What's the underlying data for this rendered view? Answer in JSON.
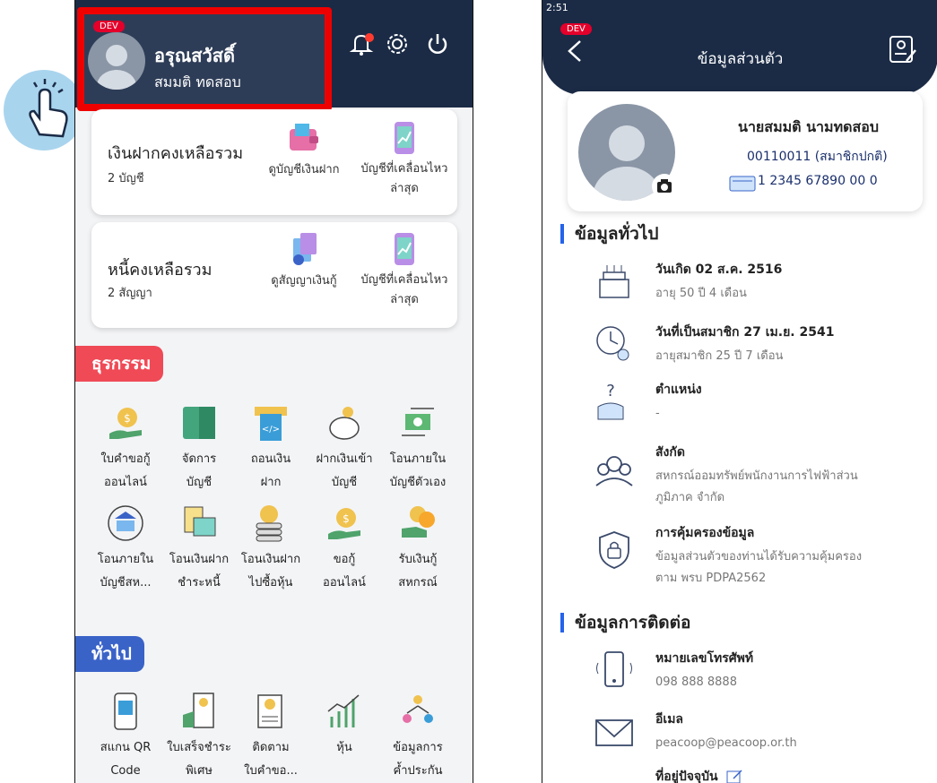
{
  "left": {
    "dev_badge": "DEV",
    "user_name": "อรุณสวัสดิ์",
    "user_sub": "สมมติ ทดสอบ",
    "deposit_card": {
      "title": "เงินฝากคงเหลือรวม",
      "sub": "2 บัญชี",
      "action1": "ดูบัญชีเงินฝาก",
      "action2_line1": "บัญชีที่เคลื่อนไหว",
      "action2_line2": "ล่าสุด"
    },
    "loan_card": {
      "title": "หนี้คงเหลือรวม",
      "sub": "2 สัญญา",
      "action1": "ดูสัญญาเงินกู้",
      "action2_line1": "บัญชีที่เคลื่อนไหว",
      "action2_line2": "ล่าสุด"
    },
    "section_transactions": "ธุรกรรม",
    "transactions": [
      {
        "l1": "ใบคำขอกู้",
        "l2": "ออนไลน์"
      },
      {
        "l1": "จัดการ",
        "l2": "บัญชี"
      },
      {
        "l1": "ถอนเงิน",
        "l2": "ฝาก"
      },
      {
        "l1": "ฝากเงินเข้า",
        "l2": "บัญชี"
      },
      {
        "l1": "โอนภายใน",
        "l2": "บัญชีตัวเอง"
      },
      {
        "l1": "โอนภายใน",
        "l2": "บัญชีสห..."
      },
      {
        "l1": "โอนเงินฝาก",
        "l2": "ชำระหนี้"
      },
      {
        "l1": "โอนเงินฝาก",
        "l2": "ไปซื้อหุ้น"
      },
      {
        "l1": "ขอกู้",
        "l2": "ออนไลน์"
      },
      {
        "l1": "รับเงินกู้",
        "l2": "สหกรณ์"
      }
    ],
    "section_general": "ทั่วไป",
    "general": [
      {
        "l1": "สแกน QR",
        "l2": "Code"
      },
      {
        "l1": "ใบเสร็จชำระ",
        "l2": "พิเศษ"
      },
      {
        "l1": "ติดตาม",
        "l2": "ใบคำขอ..."
      },
      {
        "l1": "หุ้น",
        "l2": ""
      },
      {
        "l1": "ข้อมูลการ",
        "l2": "ค้ำประกัน"
      }
    ]
  },
  "right": {
    "status_time": "2:51",
    "dev_badge": "DEV",
    "title": "ข้อมูลส่วนตัว",
    "full_name": "นายสมมติ นามทดสอบ",
    "member_no": "00110011 (สมาชิกปกติ)",
    "id_card": "1 2345 67890 00 0",
    "section_general": "ข้อมูลทั่วไป",
    "birthday_title": "วันเกิด 02 ส.ค. 2516",
    "birthday_value": "อายุ 50 ปี 4 เดือน",
    "member_since_title": "วันที่เป็นสมาชิก 27 เม.ย. 2541",
    "member_since_value": "อายุสมาชิก 25 ปี 7 เดือน",
    "position_title": "ตำแหน่ง",
    "position_value": "-",
    "affiliation_title": "สังกัด",
    "affiliation_value_l1": "สหกรณ์ออมทรัพย์พนักงานการไฟฟ้าส่วน",
    "affiliation_value_l2": "ภูมิภาค จำกัด",
    "privacy_title": "การคุ้มครองข้อมูล",
    "privacy_value_l1": "ข้อมูลส่วนตัวของท่านได้รับความคุ้มครอง",
    "privacy_value_l2": "ตาม พรบ PDPA2562",
    "section_contact": "ข้อมูลการติดต่อ",
    "phone_title": "หมายเลขโทรศัพท์",
    "phone_value": "098 888 8888",
    "email_title": "อีเมล",
    "email_value": "peacoop@peacoop.or.th",
    "address_title": "ที่อยู่ปัจจุบัน"
  }
}
